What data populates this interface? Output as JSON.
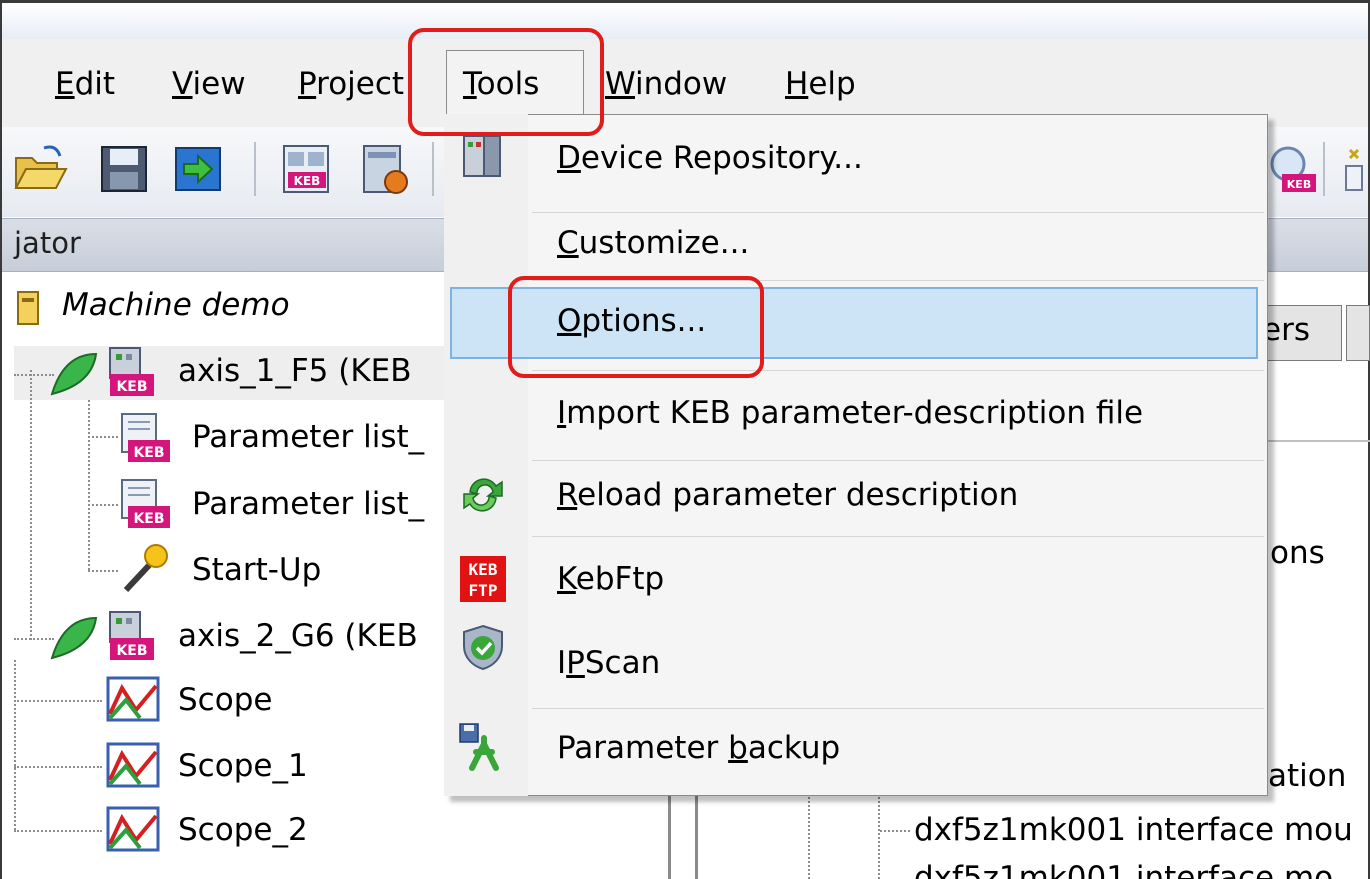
{
  "menubar": {
    "items": [
      {
        "label": "Edit",
        "accel": "E"
      },
      {
        "label": "View",
        "accel": "V"
      },
      {
        "label": "Project",
        "accel": "P"
      },
      {
        "label": "Tools",
        "accel": "T"
      },
      {
        "label": "Window",
        "accel": "W"
      },
      {
        "label": "Help",
        "accel": "H"
      }
    ]
  },
  "navigator": {
    "title": "jator",
    "tree": [
      {
        "label": "Machine demo"
      },
      {
        "label": "axis_1_F5 (KEB"
      },
      {
        "label": "Parameter list_"
      },
      {
        "label": "Parameter list_"
      },
      {
        "label": "Start-Up"
      },
      {
        "label": "axis_2_G6 (KEB"
      },
      {
        "label": "Scope"
      },
      {
        "label": "Scope_1"
      },
      {
        "label": "Scope_2"
      }
    ]
  },
  "right_panel": {
    "tab_label": "ers",
    "text_1": "ons",
    "text_2": "ation",
    "tree_row": "dxf5z1mk001 interface mou"
  },
  "tools_menu": {
    "items": [
      {
        "label": "Device Repository...",
        "accel_idx": 0,
        "icon": "device-repository-icon"
      },
      {
        "label": "Customize...",
        "accel_idx": 0,
        "icon": ""
      },
      {
        "label": "Options...",
        "accel_idx": 0,
        "icon": "",
        "highlighted": true
      },
      {
        "label": "Import KEB parameter-description file",
        "accel_idx": 0,
        "icon": ""
      },
      {
        "label": "Reload parameter description",
        "accel_idx": 0,
        "icon": "reload-icon"
      },
      {
        "label": "KebFtp",
        "accel_idx": 0,
        "icon": "keb-ftp-icon"
      },
      {
        "label": "IPScan",
        "accel_idx": 1,
        "icon": "ipscan-shield-icon"
      },
      {
        "label": "Parameter backup",
        "accel_idx": 10,
        "icon": "parameter-backup-icon"
      }
    ],
    "ftp_icon_text_top": "KEB",
    "ftp_icon_text_bottom": "FTP"
  },
  "colors": {
    "highlight_bg": "#cde4f7",
    "highlight_border": "#7cb3e3",
    "annotation_red": "#e21b1b"
  }
}
